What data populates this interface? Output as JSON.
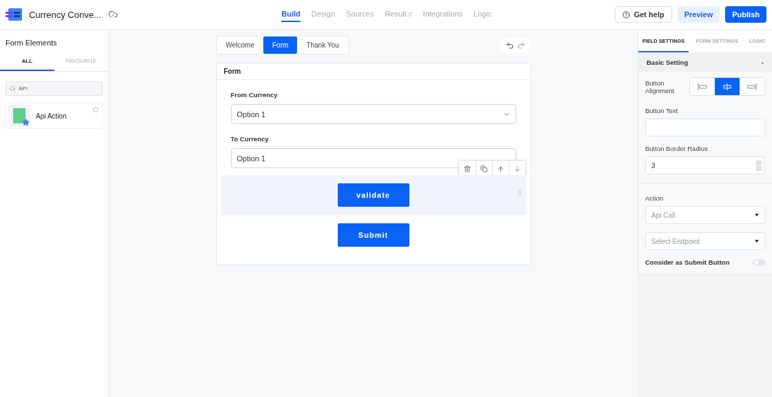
{
  "header": {
    "title": "Currency Conve...",
    "nav": [
      {
        "label": "Build",
        "selected": true,
        "external": false
      },
      {
        "label": "Design",
        "selected": false,
        "external": false
      },
      {
        "label": "Sources",
        "selected": false,
        "external": false
      },
      {
        "label": "Result",
        "selected": false,
        "external": true
      },
      {
        "label": "Integrations",
        "selected": false,
        "external": false
      },
      {
        "label": "Logic",
        "selected": false,
        "external": false
      }
    ],
    "help": "Get help",
    "preview": "Preview",
    "publish": "Publish"
  },
  "sidebar": {
    "title": "Form Elements",
    "tabs": [
      {
        "label": "ALL",
        "selected": true
      },
      {
        "label": "FAVOURITE",
        "selected": false
      }
    ],
    "search": {
      "value": "API"
    },
    "items": [
      {
        "label": "Api Action",
        "favourite": false
      }
    ]
  },
  "canvas": {
    "pages": [
      {
        "label": "Welcome",
        "selected": false
      },
      {
        "label": "Form",
        "selected": true
      },
      {
        "label": "Thank You",
        "selected": false
      }
    ],
    "form_title": "Form",
    "fields": [
      {
        "kind": "select",
        "label": "From Currency",
        "value": "Option 1",
        "selected": false
      },
      {
        "kind": "select",
        "label": "To Currency",
        "value": "Option 1",
        "selected": false
      },
      {
        "kind": "button",
        "label": "validate",
        "selected": true
      },
      {
        "kind": "button",
        "label": "Submit",
        "selected": false
      }
    ]
  },
  "settings": {
    "tabs": [
      {
        "label": "FIELD SETTINGS",
        "selected": true
      },
      {
        "label": "FORM SETTINGS",
        "selected": false
      },
      {
        "label": "LOGIC",
        "selected": false
      }
    ],
    "section": {
      "title": "Basic Setting",
      "collapse": "-"
    },
    "alignment": {
      "label": "Button Alignment",
      "options": [
        {
          "kind": "left",
          "selected": false
        },
        {
          "kind": "center",
          "selected": true
        },
        {
          "kind": "right",
          "selected": false
        }
      ]
    },
    "button_text": {
      "label": "Button Text"
    },
    "radius": {
      "label": "Button Border Radius",
      "value": "3"
    },
    "action": {
      "label": "Action",
      "value": "Api Call",
      "endpoint_placeholder": "Select Endpoint"
    },
    "submit_toggle": {
      "label": "Consider as Submit Button",
      "on": false
    }
  }
}
